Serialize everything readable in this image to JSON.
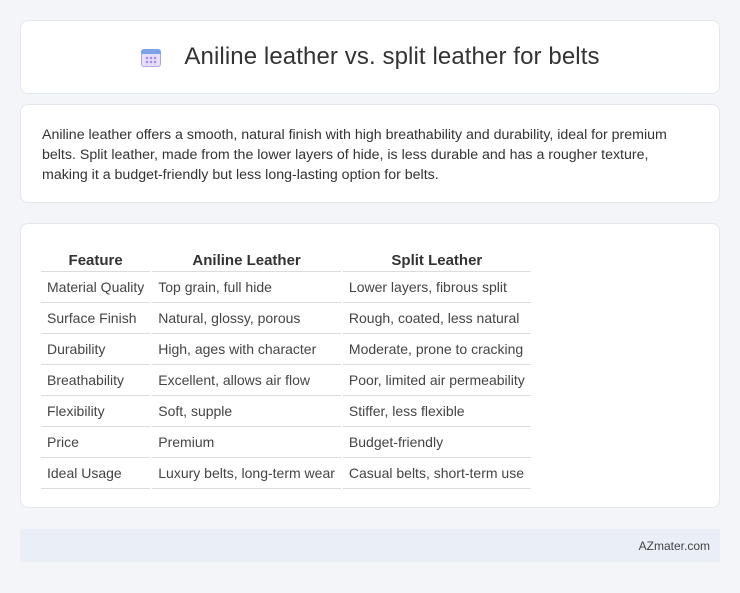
{
  "header": {
    "title": "Aniline leather vs. split leather for belts",
    "icon": "calendar-icon"
  },
  "description": {
    "text": "Aniline leather offers a smooth, natural finish with high breathability and durability, ideal for premium belts. Split leather, made from the lower layers of hide, is less durable and has a rougher texture, making it a budget-friendly but less long-lasting option for belts."
  },
  "table": {
    "headers": [
      "Feature",
      "Aniline Leather",
      "Split Leather"
    ],
    "rows": [
      [
        "Material Quality",
        "Top grain, full hide",
        "Lower layers, fibrous split"
      ],
      [
        "Surface Finish",
        "Natural, glossy, porous",
        "Rough, coated, less natural"
      ],
      [
        "Durability",
        "High, ages with character",
        "Moderate, prone to cracking"
      ],
      [
        "Breathability",
        "Excellent, allows air flow",
        "Poor, limited air permeability"
      ],
      [
        "Flexibility",
        "Soft, supple",
        "Stiffer, less flexible"
      ],
      [
        "Price",
        "Premium",
        "Budget-friendly"
      ],
      [
        "Ideal Usage",
        "Luxury belts, long-term wear",
        "Casual belts, short-term use"
      ]
    ]
  },
  "footer": {
    "brand": "AZmater.com"
  }
}
